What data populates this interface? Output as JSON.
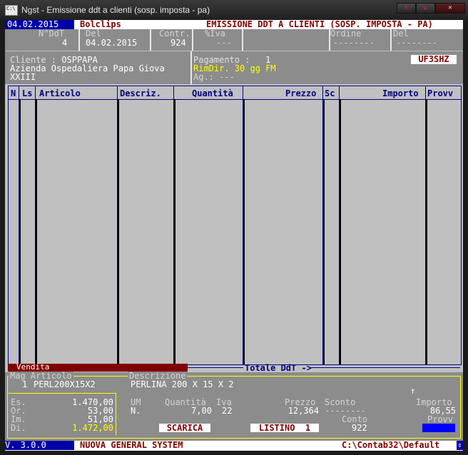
{
  "window": {
    "title": "Ngst - Emissione ddt a clienti (sosp. imposta - pa)",
    "icon_text": "C:\\",
    "controls": [
      "minimize-icon",
      "restore-icon",
      "close-icon"
    ]
  },
  "header": {
    "date": "04.02.2015",
    "company": "Bolclips",
    "screen_title": "EMISSIONE DDT A CLIENTI (SOSP. IMPOSTA - PA)"
  },
  "doc": {
    "nddt_label": "N°DdT",
    "nddt_value": "4",
    "del_label": "Del",
    "del_value": "04.02.2015",
    "contr_label": "Contr.",
    "contr_value": "924",
    "iva_label": "%Iva",
    "iva_value": "---",
    "ordine_label": "Ordine",
    "ordine_value": "--------",
    "del2_label": "Del",
    "del2_value": "--------"
  },
  "customer": {
    "label": "Cliente :",
    "code": "OSPPAPA",
    "name_line1": "Azienda Ospedaliera Papa Giova",
    "name_line2": "XXIII",
    "pagamento_label": "Pagamento :",
    "pagamento_value": "1",
    "pagamento_desc": "RimDir. 30 gg FM",
    "agent_label": "Ag.:",
    "agent_value": "---",
    "code_box": "UF3SHZ"
  },
  "grid": {
    "columns": [
      "N",
      "Ls",
      "Articolo",
      "Descriz.",
      "Quantità",
      "Prezzo",
      "Sc",
      "Importo",
      "Provv"
    ],
    "section_label": "Vendita",
    "total_label": "Totale DdT ->"
  },
  "detail": {
    "mag_label": "Mag",
    "articolo_label": "Articolo",
    "descrizione_label": "Descrizione",
    "mag_value": "1",
    "articolo_value": "PERL200X15X2",
    "descrizione_value": "PERLINA 200 X 15 X 2",
    "stock": [
      {
        "label": "Es.",
        "value": "1.470,00"
      },
      {
        "label": "Or.",
        "value": "53,00"
      },
      {
        "label": "Im.",
        "value": "51,00"
      },
      {
        "label": "Di.",
        "value": "1.472,00"
      }
    ],
    "um_label": "UM",
    "um_value": "N.",
    "quantita_label": "Quantità",
    "quantita_value": "7,00",
    "iva_label": "Iva",
    "iva_value": "22",
    "prezzo_label": "Prezzo",
    "prezzo_value": "12,364",
    "sconto_label": "Sconto",
    "sconto_value": "--------",
    "importo_label": "Importo",
    "importo_value": "86,55",
    "conto_label": "Conto",
    "conto_value": "922",
    "provv_label": "Provv",
    "scarica_button": "SCARICA",
    "listino_button": "LISTINO  1"
  },
  "status": {
    "version": "V. 3.0.0",
    "system": "NUOVA GENERAL SYSTEM",
    "path": "C:\\Contab32\\Default"
  },
  "colors": {
    "background": "#c0c0c0",
    "header_date_bg": "#0000a8",
    "accent_maroon": "#800000",
    "highlight_yellow": "#ffff00",
    "grid_line": "#00008b"
  }
}
